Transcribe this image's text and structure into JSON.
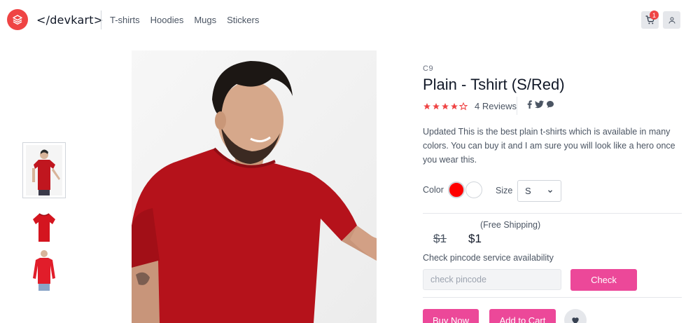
{
  "header": {
    "brand": "</devkart>",
    "nav": [
      "T-shirts",
      "Hoodies",
      "Mugs",
      "Stickers"
    ],
    "cart_count": "1"
  },
  "product": {
    "sku": "C9",
    "title": "Plain - Tshirt (S/Red)",
    "rating": 4,
    "rating_max": 5,
    "reviews": "4 Reviews",
    "description": "Updated This is the best plain t-shirts which is available in many colors. You can buy it and I am sure you will look like a hero once you wear this.",
    "color_label": "Color",
    "colors": [
      "#ff0000",
      "#ffffff"
    ],
    "size_label": "Size",
    "size_value": "S",
    "free_shipping": "(Free Shipping)",
    "old_price": "$1",
    "price": "$1",
    "pincode_label": "Check pincode service availability",
    "pincode_placeholder": "check pincode",
    "check_label": "Check",
    "buy_now_label": "Buy Now",
    "add_to_cart_label": "Add to Cart"
  },
  "icons": {
    "logo": "stack-icon",
    "cart": "cart-icon",
    "user": "user-icon",
    "social": [
      "facebook-icon",
      "twitter-icon",
      "chat-icon"
    ],
    "wishlist": "heart-icon"
  },
  "colors_theme": {
    "accent": "#ec4899",
    "logo": "#ef4444",
    "stars": "#ef4444"
  }
}
